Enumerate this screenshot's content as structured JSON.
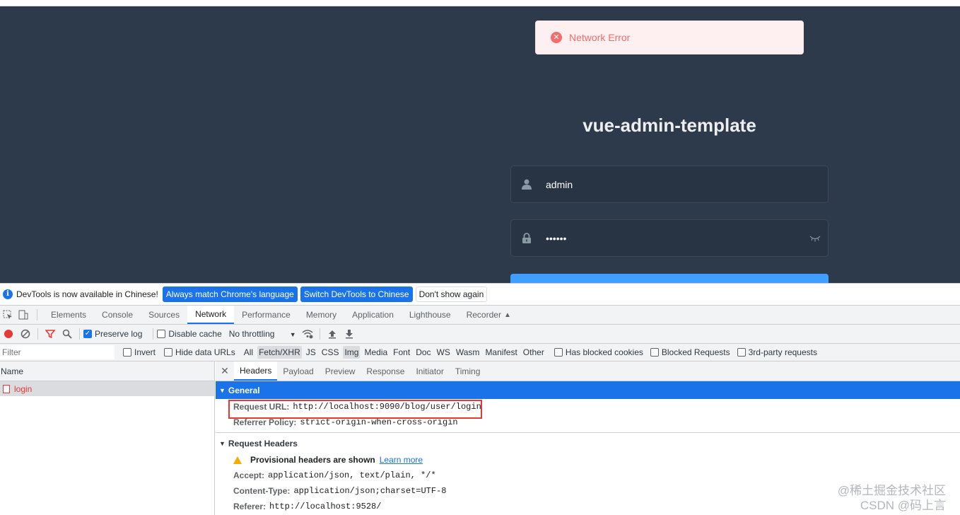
{
  "app": {
    "toast": {
      "message": "Network Error"
    },
    "title": "vue-admin-template",
    "username": {
      "value": "admin"
    },
    "password": {
      "value": "••••••"
    }
  },
  "devtools": {
    "infobar": {
      "message": "DevTools is now available in Chinese!",
      "btn_match": "Always match Chrome's language",
      "btn_switch": "Switch DevTools to Chinese",
      "btn_dismiss": "Don't show again"
    },
    "tabs": [
      "Elements",
      "Console",
      "Sources",
      "Network",
      "Performance",
      "Memory",
      "Application",
      "Lighthouse",
      "Recorder"
    ],
    "active_tab": "Network",
    "toolbar": {
      "preserve_log": "Preserve log",
      "disable_cache": "Disable cache",
      "throttling": "No throttling"
    },
    "filter": {
      "placeholder": "Filter",
      "invert": "Invert",
      "hide_data_urls": "Hide data URLs",
      "types": [
        "All",
        "Fetch/XHR",
        "JS",
        "CSS",
        "Img",
        "Media",
        "Font",
        "Doc",
        "WS",
        "Wasm",
        "Manifest",
        "Other"
      ],
      "has_blocked_cookies": "Has blocked cookies",
      "blocked_requests": "Blocked Requests",
      "third_party": "3rd-party requests"
    },
    "requests": {
      "column_name": "Name",
      "items": [
        {
          "name": "login"
        }
      ]
    },
    "detail": {
      "tabs": [
        "Headers",
        "Payload",
        "Preview",
        "Response",
        "Initiator",
        "Timing"
      ],
      "general": {
        "title": "General",
        "request_url_label": "Request URL:",
        "request_url": "http://localhost:9090/blog/user/login",
        "referrer_policy_label": "Referrer Policy:",
        "referrer_policy": "strict-origin-when-cross-origin"
      },
      "request_headers": {
        "title": "Request Headers",
        "provisional": "Provisional headers are shown",
        "learn_more": "Learn more",
        "accept_label": "Accept:",
        "accept": "application/json, text/plain, */*",
        "content_type_label": "Content-Type:",
        "content_type": "application/json;charset=UTF-8",
        "referer_label": "Referer:",
        "referer": "http://localhost:9528/"
      }
    }
  },
  "watermark": {
    "line1": "@稀土掘金技术社区",
    "line2": "CSDN @码上言"
  }
}
